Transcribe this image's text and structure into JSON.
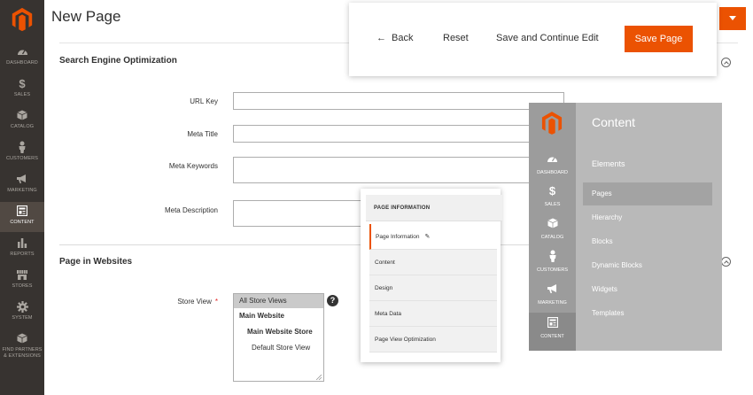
{
  "sidebar": {
    "items": [
      {
        "label": "Dashboard",
        "icon": "dashboard-icon"
      },
      {
        "label": "Sales",
        "icon": "dollar-icon"
      },
      {
        "label": "Catalog",
        "icon": "box-icon"
      },
      {
        "label": "Customers",
        "icon": "person-icon"
      },
      {
        "label": "Marketing",
        "icon": "megaphone-icon"
      },
      {
        "label": "Content",
        "icon": "content-icon"
      },
      {
        "label": "Reports",
        "icon": "bar-chart-icon"
      },
      {
        "label": "Stores",
        "icon": "store-icon"
      },
      {
        "label": "System",
        "icon": "gear-icon"
      },
      {
        "label": "Find Partners & Extensions",
        "icon": "cube-icon"
      }
    ]
  },
  "header": {
    "title": "New Page"
  },
  "toolbar": {
    "back_label": "Back",
    "reset_label": "Reset",
    "save_continue_label": "Save and Continue Edit",
    "save_label": "Save Page"
  },
  "seo": {
    "title": "Search Engine Optimization",
    "fields": {
      "url_key": "URL Key",
      "meta_title": "Meta Title",
      "meta_keywords": "Meta Keywords",
      "meta_description": "Meta Description"
    }
  },
  "websites": {
    "title": "Page in Websites",
    "store_view_label": "Store View",
    "required_mark": "*",
    "help": "?",
    "options": [
      {
        "label": "All Store Views"
      },
      {
        "label": "Main Website"
      },
      {
        "label": "Main Website Store"
      },
      {
        "label": "Default Store View"
      }
    ]
  },
  "page_info_panel": {
    "title": "PAGE INFORMATION",
    "items": [
      "Page Information",
      "Content",
      "Design",
      "Meta Data",
      "Page View Optimization"
    ]
  },
  "content_menu": {
    "title": "Content",
    "section": "Elements",
    "nav": [
      "Dashboard",
      "Sales",
      "Catalog",
      "Customers",
      "Marketing",
      "Content"
    ],
    "links": [
      "Pages",
      "Hierarchy",
      "Blocks",
      "Dynamic Blocks",
      "Widgets",
      "Templates"
    ]
  },
  "colors": {
    "accent": "#eb5202",
    "sidebar_bg": "#373330"
  }
}
